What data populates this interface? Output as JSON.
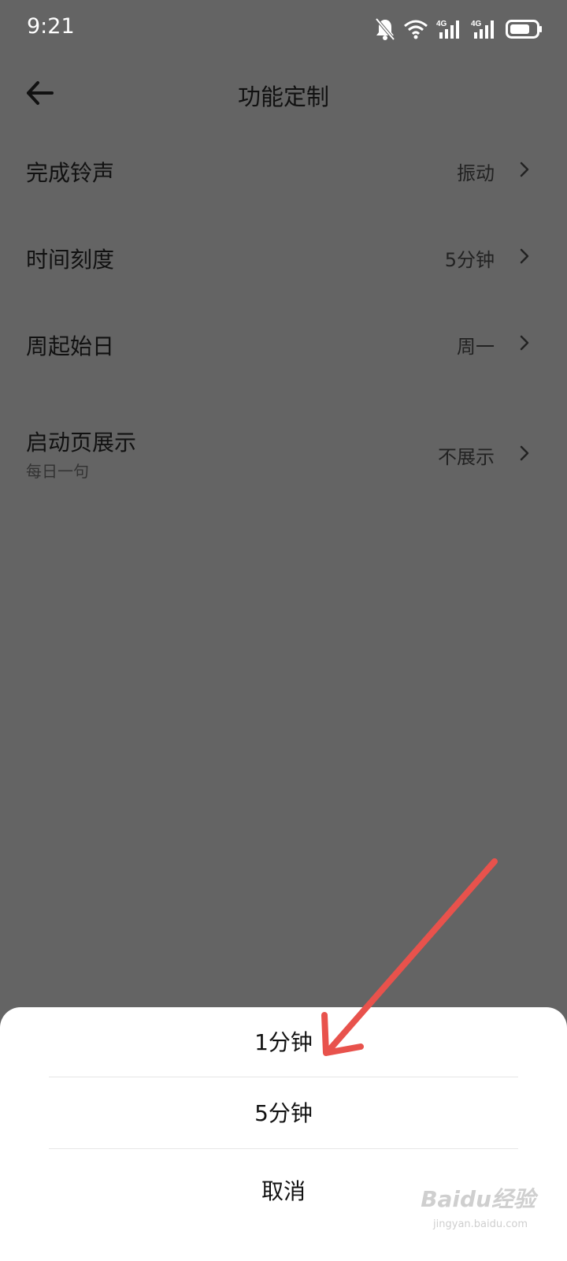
{
  "status_bar": {
    "time": "9:21",
    "icons": [
      "bell-muted-icon",
      "wifi-icon",
      "signal-4g-icon",
      "signal-4g-icon",
      "battery-icon"
    ],
    "network_label": "4G"
  },
  "header": {
    "title": "功能定制",
    "back_icon": "arrow-left-icon"
  },
  "settings": [
    {
      "label": "完成铃声",
      "value": "振动"
    },
    {
      "label": "时间刻度",
      "value": "5分钟"
    },
    {
      "label": "周起始日",
      "value": "周一"
    },
    {
      "label": "启动页展示",
      "sub": "每日一句",
      "value": "不展示"
    }
  ],
  "sheet": {
    "options": [
      "1分钟",
      "5分钟"
    ],
    "cancel": "取消"
  },
  "annotation": {
    "arrow_color": "#e8524c"
  },
  "watermark": {
    "logo": "Baidu经验",
    "url": "jingyan.baidu.com"
  },
  "colors": {
    "overlay_bg": "#646464",
    "sheet_bg": "#ffffff",
    "accent_arrow": "#e8524c"
  }
}
